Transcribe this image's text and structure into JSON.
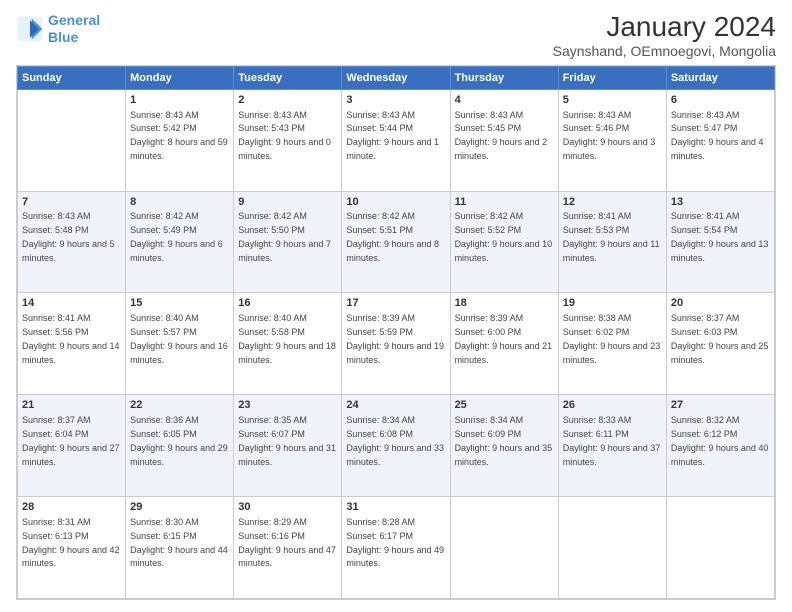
{
  "logo": {
    "line1": "General",
    "line2": "Blue"
  },
  "title": "January 2024",
  "subtitle": "Saynshand, OEmnoegovi, Mongolia",
  "weekdays": [
    "Sunday",
    "Monday",
    "Tuesday",
    "Wednesday",
    "Thursday",
    "Friday",
    "Saturday"
  ],
  "weeks": [
    [
      {
        "day": "",
        "sunrise": "",
        "sunset": "",
        "daylight": ""
      },
      {
        "day": "1",
        "sunrise": "Sunrise: 8:43 AM",
        "sunset": "Sunset: 5:42 PM",
        "daylight": "Daylight: 8 hours and 59 minutes."
      },
      {
        "day": "2",
        "sunrise": "Sunrise: 8:43 AM",
        "sunset": "Sunset: 5:43 PM",
        "daylight": "Daylight: 9 hours and 0 minutes."
      },
      {
        "day": "3",
        "sunrise": "Sunrise: 8:43 AM",
        "sunset": "Sunset: 5:44 PM",
        "daylight": "Daylight: 9 hours and 1 minute."
      },
      {
        "day": "4",
        "sunrise": "Sunrise: 8:43 AM",
        "sunset": "Sunset: 5:45 PM",
        "daylight": "Daylight: 9 hours and 2 minutes."
      },
      {
        "day": "5",
        "sunrise": "Sunrise: 8:43 AM",
        "sunset": "Sunset: 5:46 PM",
        "daylight": "Daylight: 9 hours and 3 minutes."
      },
      {
        "day": "6",
        "sunrise": "Sunrise: 8:43 AM",
        "sunset": "Sunset: 5:47 PM",
        "daylight": "Daylight: 9 hours and 4 minutes."
      }
    ],
    [
      {
        "day": "7",
        "sunrise": "Sunrise: 8:43 AM",
        "sunset": "Sunset: 5:48 PM",
        "daylight": "Daylight: 9 hours and 5 minutes."
      },
      {
        "day": "8",
        "sunrise": "Sunrise: 8:42 AM",
        "sunset": "Sunset: 5:49 PM",
        "daylight": "Daylight: 9 hours and 6 minutes."
      },
      {
        "day": "9",
        "sunrise": "Sunrise: 8:42 AM",
        "sunset": "Sunset: 5:50 PM",
        "daylight": "Daylight: 9 hours and 7 minutes."
      },
      {
        "day": "10",
        "sunrise": "Sunrise: 8:42 AM",
        "sunset": "Sunset: 5:51 PM",
        "daylight": "Daylight: 9 hours and 8 minutes."
      },
      {
        "day": "11",
        "sunrise": "Sunrise: 8:42 AM",
        "sunset": "Sunset: 5:52 PM",
        "daylight": "Daylight: 9 hours and 10 minutes."
      },
      {
        "day": "12",
        "sunrise": "Sunrise: 8:41 AM",
        "sunset": "Sunset: 5:53 PM",
        "daylight": "Daylight: 9 hours and 11 minutes."
      },
      {
        "day": "13",
        "sunrise": "Sunrise: 8:41 AM",
        "sunset": "Sunset: 5:54 PM",
        "daylight": "Daylight: 9 hours and 13 minutes."
      }
    ],
    [
      {
        "day": "14",
        "sunrise": "Sunrise: 8:41 AM",
        "sunset": "Sunset: 5:56 PM",
        "daylight": "Daylight: 9 hours and 14 minutes."
      },
      {
        "day": "15",
        "sunrise": "Sunrise: 8:40 AM",
        "sunset": "Sunset: 5:57 PM",
        "daylight": "Daylight: 9 hours and 16 minutes."
      },
      {
        "day": "16",
        "sunrise": "Sunrise: 8:40 AM",
        "sunset": "Sunset: 5:58 PM",
        "daylight": "Daylight: 9 hours and 18 minutes."
      },
      {
        "day": "17",
        "sunrise": "Sunrise: 8:39 AM",
        "sunset": "Sunset: 5:59 PM",
        "daylight": "Daylight: 9 hours and 19 minutes."
      },
      {
        "day": "18",
        "sunrise": "Sunrise: 8:39 AM",
        "sunset": "Sunset: 6:00 PM",
        "daylight": "Daylight: 9 hours and 21 minutes."
      },
      {
        "day": "19",
        "sunrise": "Sunrise: 8:38 AM",
        "sunset": "Sunset: 6:02 PM",
        "daylight": "Daylight: 9 hours and 23 minutes."
      },
      {
        "day": "20",
        "sunrise": "Sunrise: 8:37 AM",
        "sunset": "Sunset: 6:03 PM",
        "daylight": "Daylight: 9 hours and 25 minutes."
      }
    ],
    [
      {
        "day": "21",
        "sunrise": "Sunrise: 8:37 AM",
        "sunset": "Sunset: 6:04 PM",
        "daylight": "Daylight: 9 hours and 27 minutes."
      },
      {
        "day": "22",
        "sunrise": "Sunrise: 8:36 AM",
        "sunset": "Sunset: 6:05 PM",
        "daylight": "Daylight: 9 hours and 29 minutes."
      },
      {
        "day": "23",
        "sunrise": "Sunrise: 8:35 AM",
        "sunset": "Sunset: 6:07 PM",
        "daylight": "Daylight: 9 hours and 31 minutes."
      },
      {
        "day": "24",
        "sunrise": "Sunrise: 8:34 AM",
        "sunset": "Sunset: 6:08 PM",
        "daylight": "Daylight: 9 hours and 33 minutes."
      },
      {
        "day": "25",
        "sunrise": "Sunrise: 8:34 AM",
        "sunset": "Sunset: 6:09 PM",
        "daylight": "Daylight: 9 hours and 35 minutes."
      },
      {
        "day": "26",
        "sunrise": "Sunrise: 8:33 AM",
        "sunset": "Sunset: 6:11 PM",
        "daylight": "Daylight: 9 hours and 37 minutes."
      },
      {
        "day": "27",
        "sunrise": "Sunrise: 8:32 AM",
        "sunset": "Sunset: 6:12 PM",
        "daylight": "Daylight: 9 hours and 40 minutes."
      }
    ],
    [
      {
        "day": "28",
        "sunrise": "Sunrise: 8:31 AM",
        "sunset": "Sunset: 6:13 PM",
        "daylight": "Daylight: 9 hours and 42 minutes."
      },
      {
        "day": "29",
        "sunrise": "Sunrise: 8:30 AM",
        "sunset": "Sunset: 6:15 PM",
        "daylight": "Daylight: 9 hours and 44 minutes."
      },
      {
        "day": "30",
        "sunrise": "Sunrise: 8:29 AM",
        "sunset": "Sunset: 6:16 PM",
        "daylight": "Daylight: 9 hours and 47 minutes."
      },
      {
        "day": "31",
        "sunrise": "Sunrise: 8:28 AM",
        "sunset": "Sunset: 6:17 PM",
        "daylight": "Daylight: 9 hours and 49 minutes."
      },
      {
        "day": "",
        "sunrise": "",
        "sunset": "",
        "daylight": ""
      },
      {
        "day": "",
        "sunrise": "",
        "sunset": "",
        "daylight": ""
      },
      {
        "day": "",
        "sunrise": "",
        "sunset": "",
        "daylight": ""
      }
    ]
  ]
}
